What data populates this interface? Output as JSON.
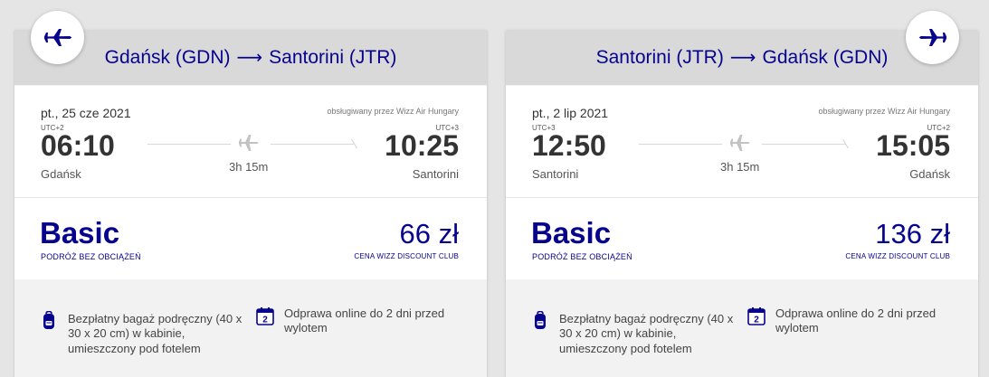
{
  "colors": {
    "brand": "#06038d",
    "background": "#e5e5e5",
    "header": "#d9d9d9",
    "card_white": "#ffffff",
    "features_bg": "#f2f2f2",
    "text": "#333333"
  },
  "cards": [
    {
      "route": {
        "from": "Gdańsk (GDN)",
        "arrow": "⟶",
        "to": "Santorini (JTR)"
      },
      "date": "pt., 25 cze 2021",
      "operated_by": "obsługiwany przez Wizz Air Hungary",
      "departure": {
        "tz": "UTC+2",
        "time": "06:10",
        "city": "Gdańsk"
      },
      "arrival": {
        "tz": "UTC+3",
        "time": "10:25",
        "city": "Santorini"
      },
      "duration": "3h 15m",
      "fare": {
        "name": "Basic",
        "subtitle": "PODRÓŻ BEZ OBCIĄŻEŃ",
        "price": "66 zł",
        "price_note": "CENA WIZZ DISCOUNT CLUB"
      },
      "features": [
        {
          "icon": "backpack-icon",
          "text": "Bezpłatny bagaż podręczny (40 x 30 x 20 cm) w kabinie, umieszczony pod fotelem"
        },
        {
          "icon": "calendar-icon",
          "icon_text": "2",
          "text": "Odprawa online do 2 dni przed wylotem"
        }
      ]
    },
    {
      "route": {
        "from": "Santorini (JTR)",
        "arrow": "⟶",
        "to": "Gdańsk (GDN)"
      },
      "date": "pt., 2 lip 2021",
      "operated_by": "obsługiwany przez Wizz Air Hungary",
      "departure": {
        "tz": "UTC+3",
        "time": "12:50",
        "city": "Santorini"
      },
      "arrival": {
        "tz": "UTC+2",
        "time": "15:05",
        "city": "Gdańsk"
      },
      "duration": "3h 15m",
      "fare": {
        "name": "Basic",
        "subtitle": "PODRÓŻ BEZ OBCIĄŻEŃ",
        "price": "136 zł",
        "price_note": "CENA WIZZ DISCOUNT CLUB"
      },
      "features": [
        {
          "icon": "backpack-icon",
          "text": "Bezpłatny bagaż podręczny (40 x 30 x 20 cm) w kabinie, umieszczony pod fotelem"
        },
        {
          "icon": "calendar-icon",
          "icon_text": "2",
          "text": "Odprawa online do 2 dni przed wylotem"
        }
      ]
    }
  ]
}
